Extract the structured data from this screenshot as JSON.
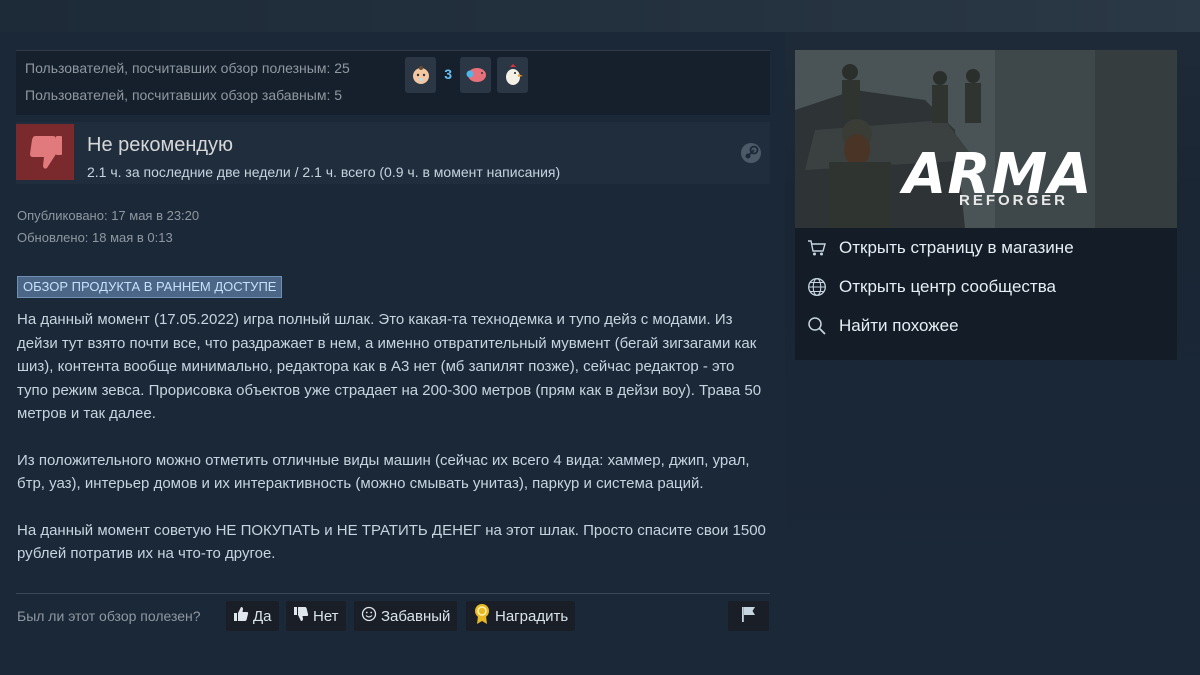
{
  "votes": {
    "helpful": "Пользователей, посчитавших обзор полезным: 25",
    "funny": "Пользователей, посчитавших обзор забавным: 5",
    "award_count": "3",
    "awards": [
      "baby-face-award-icon",
      "pig-award-icon",
      "chicken-award-icon"
    ]
  },
  "review": {
    "verdict": "Не рекомендую",
    "hours": "2.1 ч. за последние две недели / 2.1 ч. всего (0.9 ч. в момент написания)",
    "published": "Опубликовано: 17 мая в 23:20",
    "updated": "Обновлено: 18 мая в 0:13",
    "badge": "ОБЗОР ПРОДУКТА В РАННЕМ ДОСТУПЕ",
    "paragraphs": [
      "На данный момент (17.05.2022) игра полный шлак. Это какая-та технодемка и тупо дейз с модами. Из дейзи тут взято почти все, что раздражает в нем, а именно отвратительный мувмент (бегай зигзагами как шиз), контента вообще минимально, редактора как в А3 нет (мб запилят позже), сейчас редактор - это тупо режим зевса. Прорисовка объектов уже страдает на 200-300 метров (прям как в дейзи воу). Трава 50 метров и так далее.",
      "Из положительного можно отметить отличные виды машин (сейчас их всего 4 вида: хаммер, джип, урал, бтр, уаз), интерьер домов и их интерактивность (можно смывать унитаз), паркур и система раций.",
      "На данный момент советую НЕ ПОКУПАТЬ и НЕ ТРАТИТЬ ДЕНЕГ на этот шлак. Просто спасите свои 1500 рублей потратив их на что-то другое."
    ]
  },
  "footer": {
    "question": "Был ли этот обзор полезен?",
    "yes": "Да",
    "no": "Нет",
    "funny": "Забавный",
    "award": "Наградить"
  },
  "game": {
    "logo_title": "ARMA",
    "logo_sub": "REFORGER",
    "links": [
      {
        "label": "Открыть страницу в магазине",
        "icon": "cart-icon"
      },
      {
        "label": "Открыть центр сообщества",
        "icon": "globe-icon"
      },
      {
        "label": "Найти похожее",
        "icon": "search-icon"
      }
    ]
  },
  "colors": {
    "background": "#1b2838",
    "not_recommended": "#7a2a2c",
    "link": "#66c0f4",
    "badge_bg": "#4b6686"
  }
}
